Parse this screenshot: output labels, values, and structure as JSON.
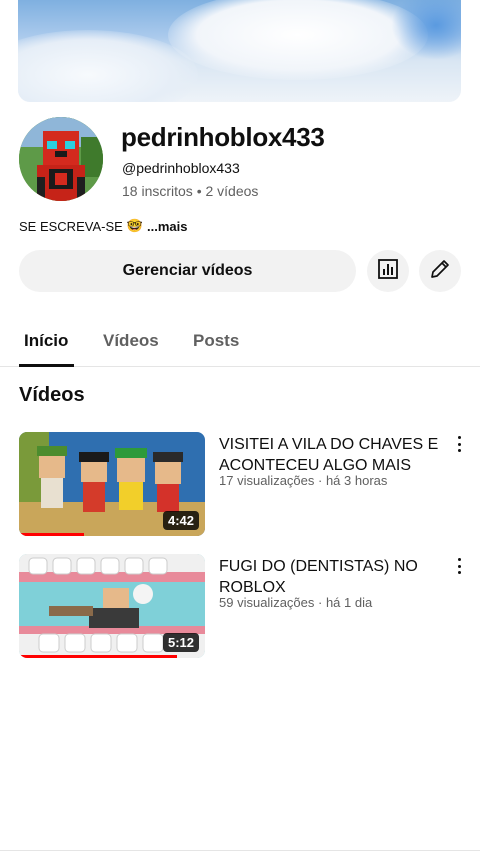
{
  "channel": {
    "name": "pedrinhoblox433",
    "handle": "@pedrinhoblox433",
    "stats": "18 inscritos • 2 vídeos",
    "description": "SE ESCREVA-SE",
    "description_emoji": "🤓",
    "more_label": "...mais"
  },
  "actions": {
    "manage_label": "Gerenciar vídeos"
  },
  "tabs": [
    {
      "label": "Início",
      "active": true
    },
    {
      "label": "Vídeos",
      "active": false
    },
    {
      "label": "Posts",
      "active": false
    }
  ],
  "videos_section": {
    "title": "Vídeos",
    "items": [
      {
        "title": "VISITEI A VILA DO CHAVES E ACONTECEU ALGO MAIS",
        "meta": "17 visualizações · há 3 horas",
        "duration": "4:42",
        "watched_fraction": 0.35
      },
      {
        "title": "FUGI DO (DENTISTAS) NO ROBLOX",
        "meta": "59 visualizações · há 1 dia",
        "duration": "5:12",
        "watched_fraction": 0.85
      }
    ]
  },
  "colors": {
    "accent": "#ff0000",
    "secondary_text": "#606060",
    "button_bg": "#f2f2f2"
  },
  "icons": [
    "analytics-icon",
    "pencil-icon",
    "more-vert-icon"
  ]
}
